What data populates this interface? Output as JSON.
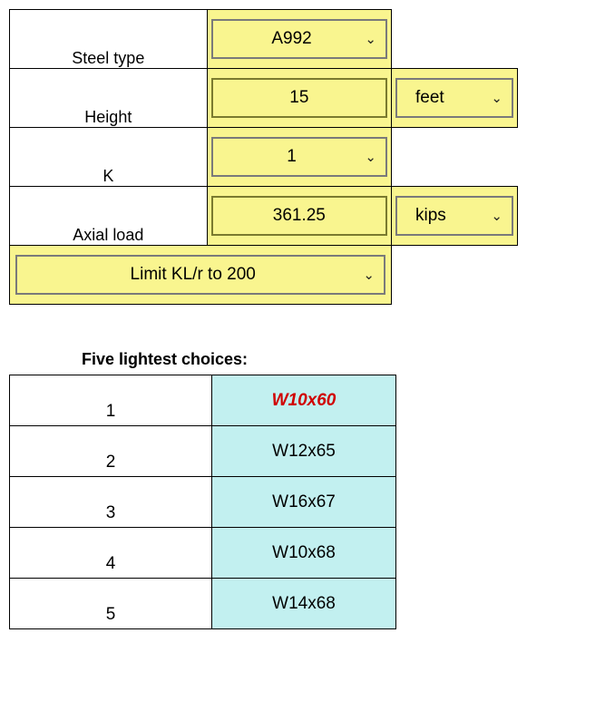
{
  "inputs": {
    "steel_type_label": "Steel type",
    "steel_type_value": "A992",
    "height_label": "Height",
    "height_value": "15",
    "height_unit": "feet",
    "k_label": "K",
    "k_value": "1",
    "axial_label": "Axial load",
    "axial_value": "361.25",
    "axial_unit": "kips",
    "limit_label": "Limit KL/r to 200"
  },
  "results": {
    "heading": "Five lightest choices:",
    "rows": [
      {
        "rank": "1",
        "shape": "W10x60"
      },
      {
        "rank": "2",
        "shape": "W12x65"
      },
      {
        "rank": "3",
        "shape": "W16x67"
      },
      {
        "rank": "4",
        "shape": "W10x68"
      },
      {
        "rank": "5",
        "shape": "W14x68"
      }
    ]
  }
}
